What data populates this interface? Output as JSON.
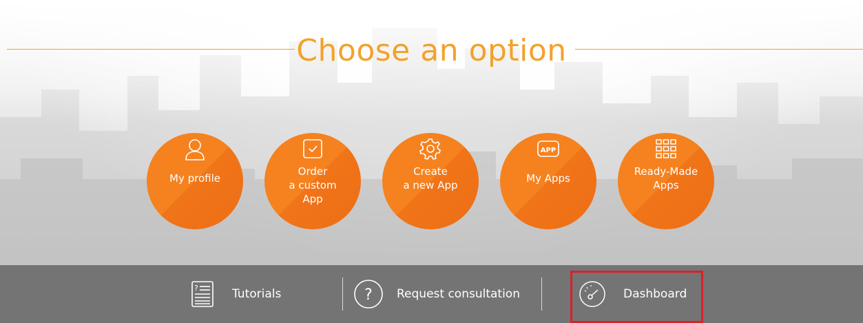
{
  "page": {
    "title": "Choose an option"
  },
  "options": [
    {
      "label": "My profile",
      "icon": "user-icon"
    },
    {
      "label": "Order\na custom\nApp",
      "icon": "checkbox-icon"
    },
    {
      "label": "Create\na new App",
      "icon": "gear-icon"
    },
    {
      "label": "My Apps",
      "icon": "app-icon"
    },
    {
      "label": "Ready-Made\nApps",
      "icon": "grid-icon"
    }
  ],
  "footer": {
    "tutorials": {
      "label": "Tutorials",
      "icon": "document-icon"
    },
    "consultation": {
      "label": "Request consultation",
      "icon": "question-icon"
    },
    "dashboard": {
      "label": "Dashboard",
      "icon": "speedometer-icon"
    }
  },
  "colors": {
    "accent": "#f5821f",
    "title": "#f4a12a",
    "footer_bg": "#747474",
    "highlight": "#d9202a"
  }
}
